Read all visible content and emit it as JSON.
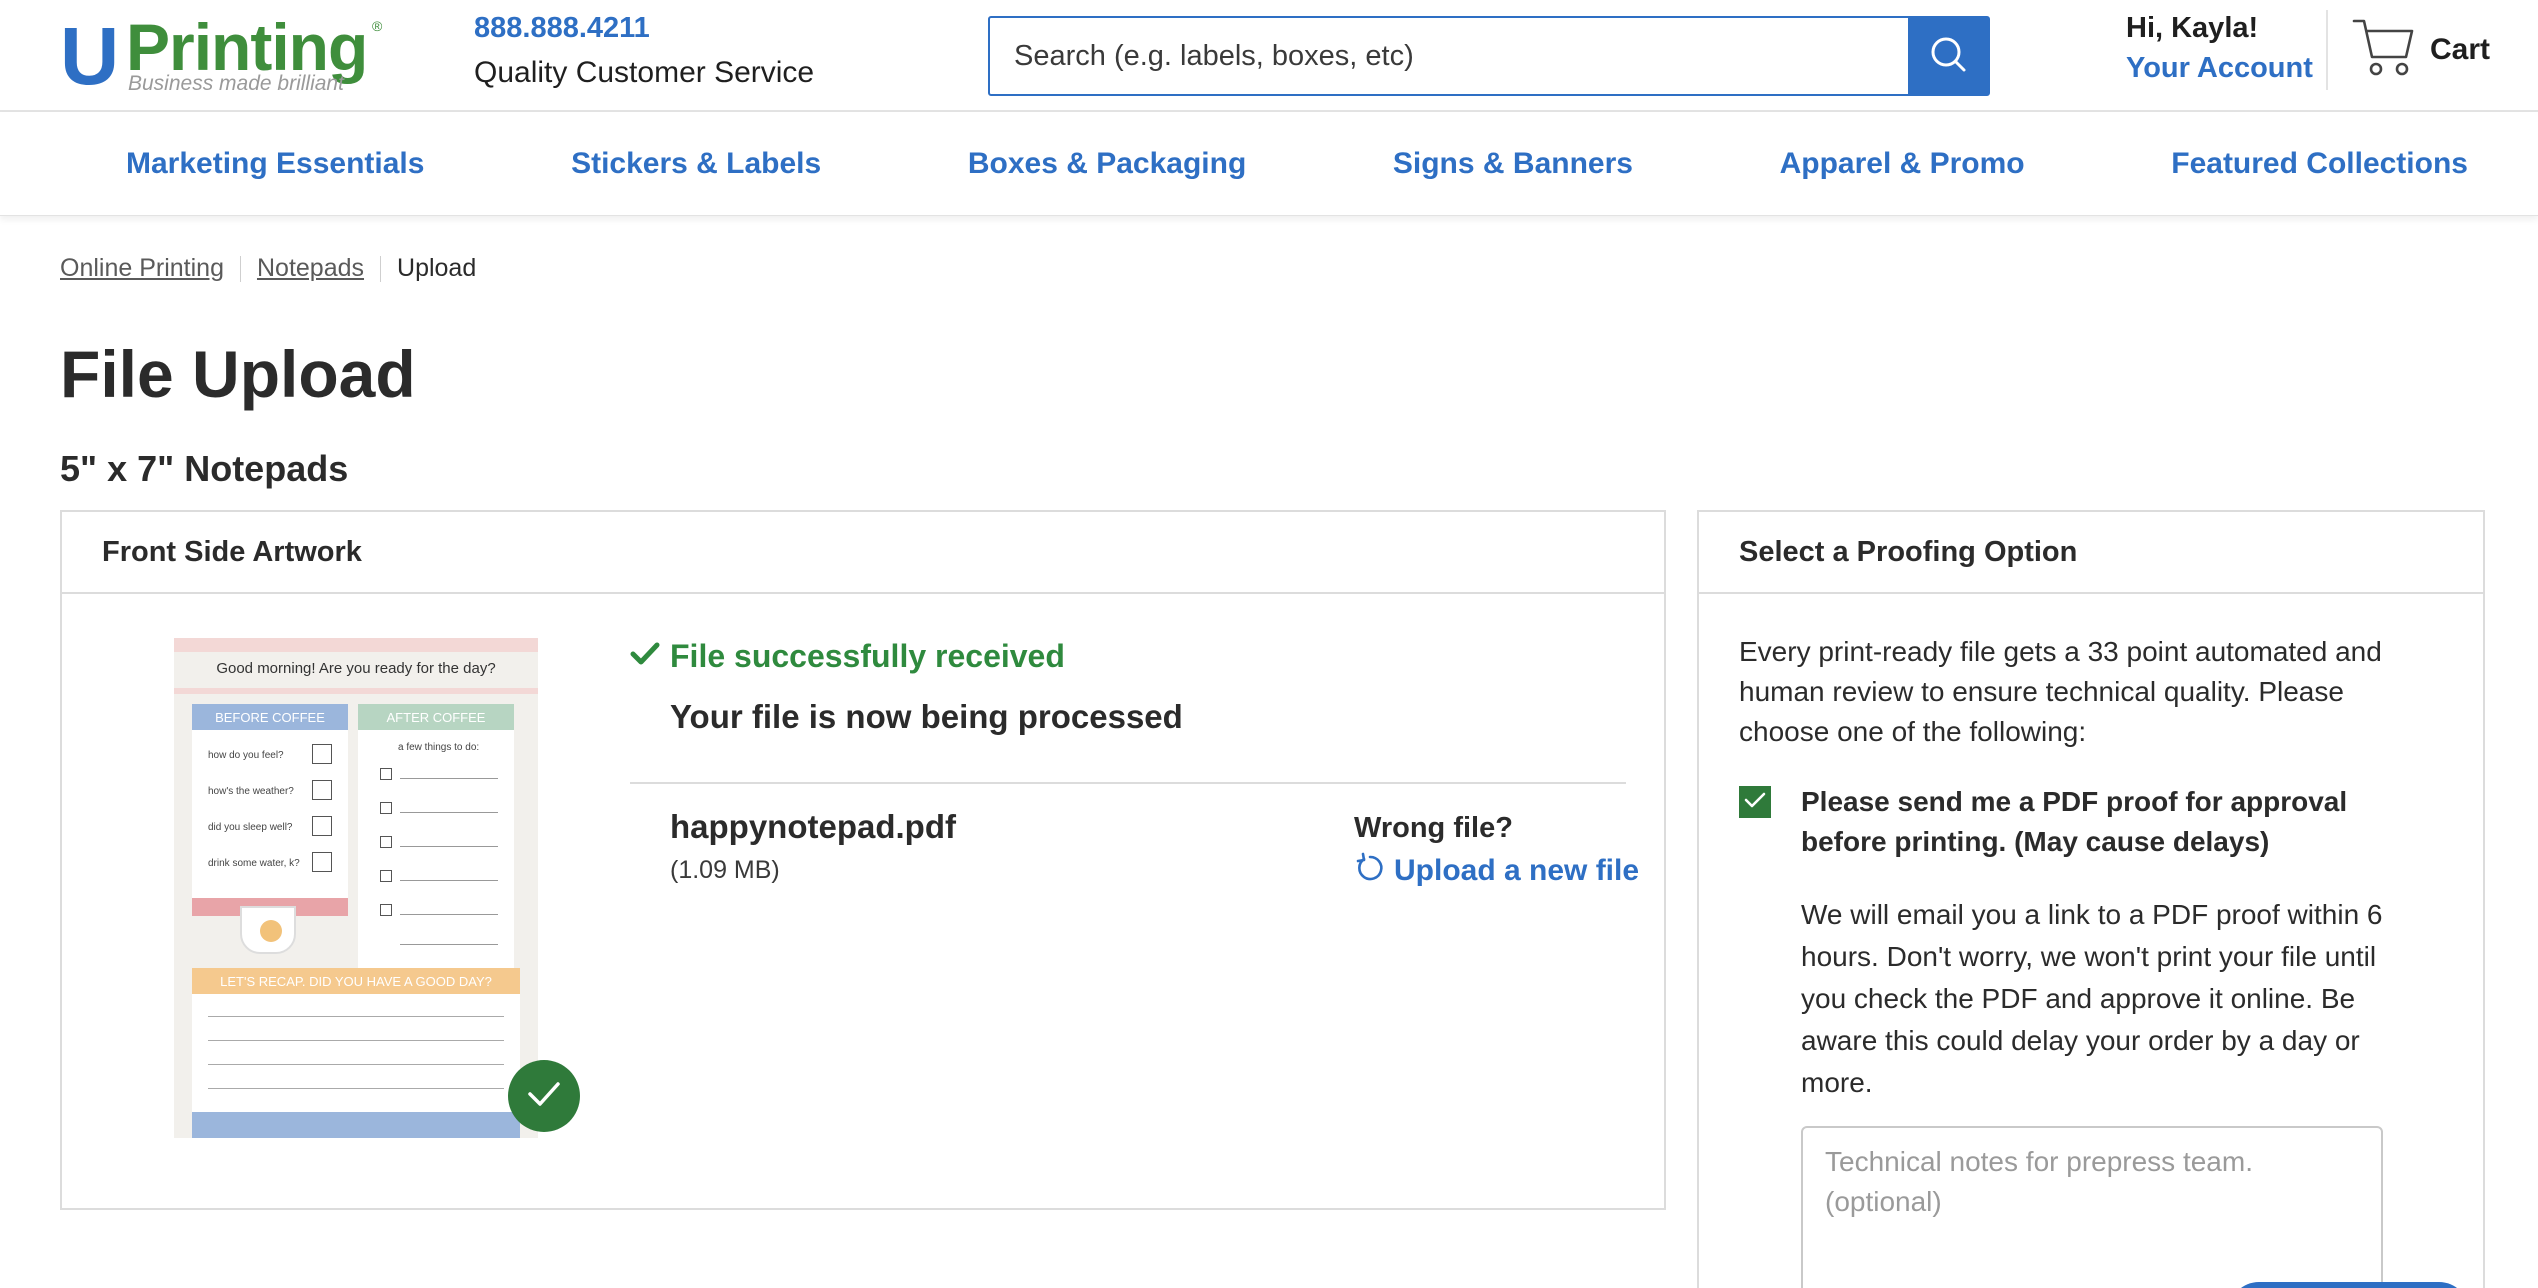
{
  "header": {
    "logo_letter": "U",
    "logo_word": "Printing",
    "logo_reg": "®",
    "logo_tagline": "Business made brilliant",
    "phone": "888.888.4211",
    "service": "Quality Customer Service",
    "search_placeholder": "Search (e.g. labels, boxes, etc)",
    "greeting": "Hi, Kayla!",
    "account_link": "Your Account",
    "cart_label": "Cart"
  },
  "nav": {
    "items": [
      "Marketing Essentials",
      "Stickers & Labels",
      "Boxes & Packaging",
      "Signs & Banners",
      "Apparel & Promo",
      "Featured Collections"
    ]
  },
  "breadcrumb": [
    "Online Printing",
    "Notepads",
    "Upload"
  ],
  "page": {
    "title": "File Upload",
    "product": "5\" x 7\" Notepads"
  },
  "artwork": {
    "heading": "Front Side Artwork",
    "status": "File successfully received",
    "processing": "Your file is now being processed",
    "file_name": "happynotepad.pdf",
    "file_size": "(1.09 MB)",
    "wrong_file": "Wrong file?",
    "upload_new": "Upload a new file",
    "thumbnail": {
      "title": "Good morning! Are you ready for the day?",
      "col1": "BEFORE COFFEE",
      "col2": "AFTER COFFEE",
      "questions": [
        "how do you feel?",
        "how's the weather?",
        "did you sleep well?",
        "drink some water, k?"
      ],
      "few_things": "a few things to do:",
      "recap": "LET'S RECAP. DID YOU HAVE A GOOD DAY?"
    }
  },
  "proofing": {
    "heading": "Select a Proofing Option",
    "intro": "Every print-ready file gets a 33 point automated and human review to ensure technical quality. Please choose one of the following:",
    "option_label": "Please send me a PDF proof for approval before printing. (May cause delays)",
    "option_checked": true,
    "option_desc": "We will email you a link to a PDF proof within 6 hours. Don't worry, we won't print your file until you check the PDF and approve it online. Be aware this could delay your order by a day or more.",
    "notes_placeholder": "Technical notes for prepress team. (optional)"
  },
  "colors": {
    "brand_blue": "#2e6fc4",
    "brand_green": "#3f8e3c",
    "success_green": "#2f8a3e"
  },
  "icons": [
    "search-icon",
    "cart-icon",
    "checkmark-icon",
    "refresh-icon",
    "checkbox-check-icon"
  ]
}
